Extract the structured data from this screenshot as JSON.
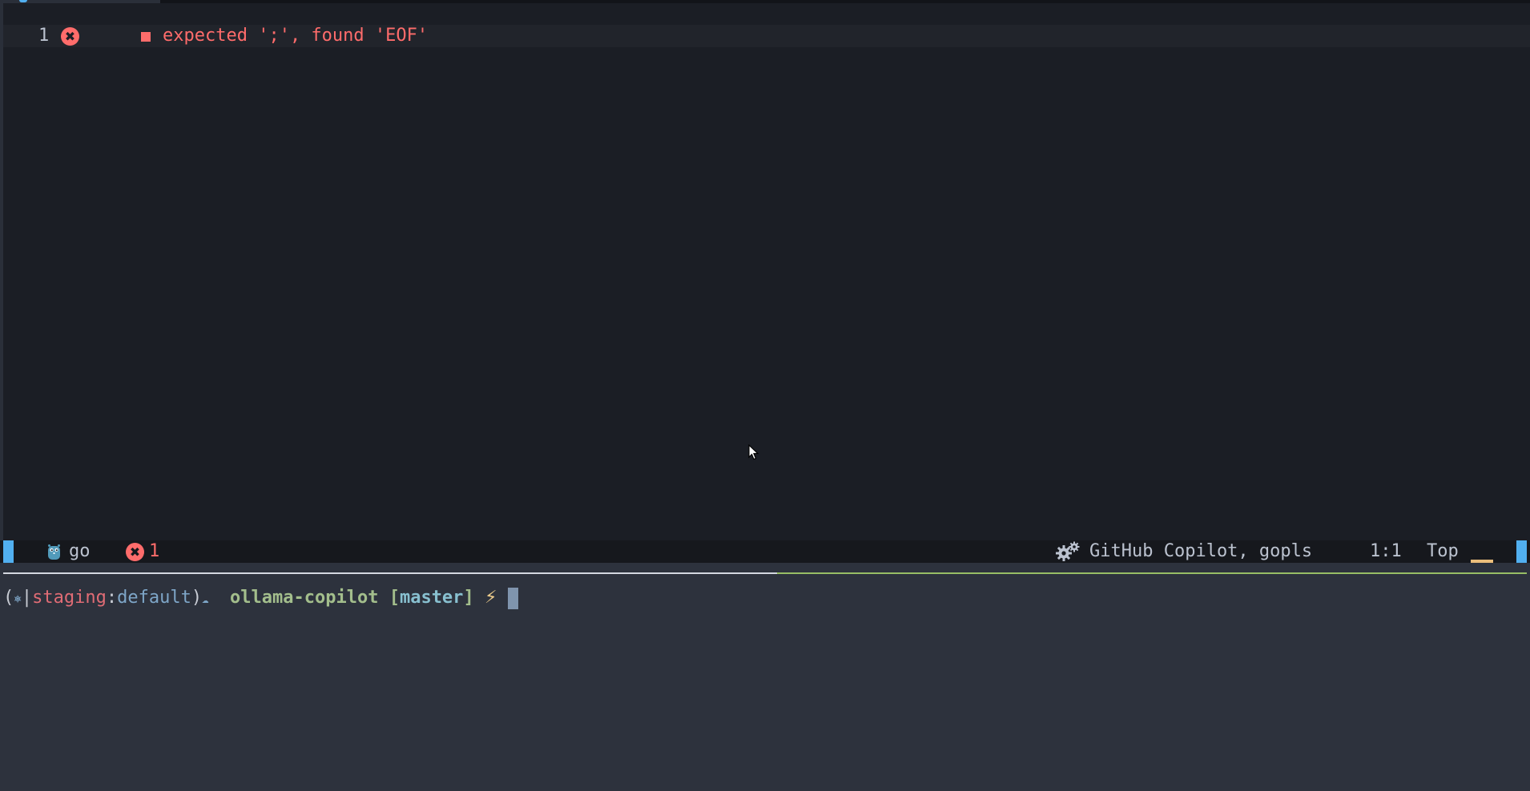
{
  "editor": {
    "line_number": "1",
    "error_sign_glyph": "✖",
    "diagnostic_marker": "■",
    "diagnostic_message": "expected ';', found 'EOF'"
  },
  "statusline": {
    "filetype": "go",
    "filetype_icon": "go-gopher-icon",
    "error_glyph": "✖",
    "error_count": "1",
    "lsp_icon": "gears-icon",
    "lsp_clients": "GitHub Copilot, gopls",
    "position": "1:1",
    "scroll": "Top"
  },
  "terminal": {
    "open_paren": "(",
    "k8s_glyph": "⎈",
    "pipe": "|",
    "context": "staging",
    "colon": ":",
    "namespace": "default",
    "close_paren": ")",
    "cloud_glyph": "☁",
    "directory": "ollama-copilot",
    "branch_open": "[",
    "branch": "master",
    "branch_close": "]",
    "bolt": "⚡"
  },
  "colors": {
    "editor_bg": "#1b1e25",
    "terminal_bg": "#2d323d",
    "error": "#ff6c6b",
    "accent_blue": "#51afef",
    "accent_green": "#98be65",
    "accent_yellow": "#ecbe7b"
  }
}
